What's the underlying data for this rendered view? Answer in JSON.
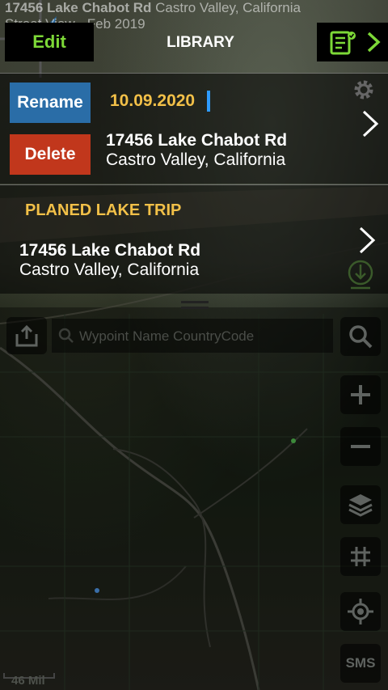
{
  "streetview": {
    "title_bold": "17456 Lake Chabot Rd",
    "title_rest": " Castro Valley, California",
    "subtitle": "Street View - Feb 2019"
  },
  "header": {
    "edit_label": "Edit",
    "title": "LIBRARY",
    "list_icon": "checklist-icon",
    "chevron_icon": "chevron-right-icon"
  },
  "entries": [
    {
      "rename_label": "Rename",
      "delete_label": "Delete",
      "date_value": "10.09.2020",
      "address_line1": "17456 Lake Chabot Rd",
      "address_line2": "Castro Valley, California"
    },
    {
      "trip_name": "PLANED LAKE TRIP",
      "address_line1": "17456 Lake Chabot Rd",
      "address_line2": "Castro Valley, California"
    }
  ],
  "search": {
    "placeholder": "Wypoint Name CountryCode"
  },
  "map_controls": {
    "sms_label": "SMS",
    "scale_label": "46 Mil"
  },
  "colors": {
    "edit_green": "#7dd837",
    "accent_yellow": "#f2c048",
    "rename_blue": "#2a6da7",
    "delete_red": "#c1371c",
    "caret_blue": "#2e9bff"
  }
}
